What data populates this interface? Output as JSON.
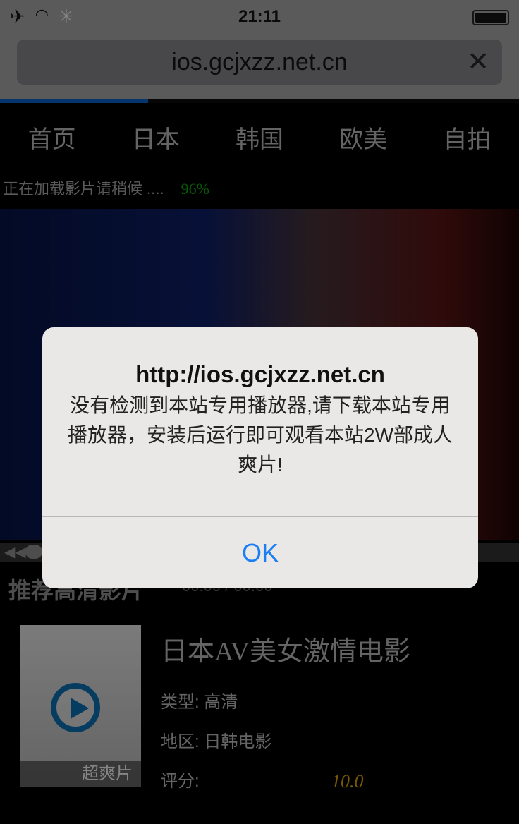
{
  "status_bar": {
    "time": "21:11",
    "icons": [
      "airplane-icon",
      "wifi-icon",
      "activity-spinner-icon",
      "battery-icon"
    ]
  },
  "browser": {
    "url": "ios.gcjxzz.net.cn",
    "load_progress_percent": 28.5
  },
  "nav": {
    "items": [
      "首页",
      "日本",
      "韩国",
      "欧美",
      "自拍"
    ]
  },
  "loading": {
    "text": "正在加载影片请稍候 ....",
    "percent": "96%"
  },
  "player": {
    "timecode": "00:00 / 00:00"
  },
  "section_title": "推荐高清影片",
  "movie": {
    "badge": "超爽片",
    "title": "日本AV美女激情电影",
    "type_label": "类型:",
    "type_value": "高清",
    "region_label": "地区:",
    "region_value": "日韩电影",
    "score_label": "评分:",
    "score_value": "10.0"
  },
  "alert": {
    "title": "http://ios.gcjxzz.net.cn",
    "message": "没有检测到本站专用播放器,请下载本站专用播放器，安装后运行即可观看本站2W部成人爽片!",
    "ok_label": "OK"
  },
  "colors": {
    "accent": "#1a7ef5",
    "progress": "#0a52a8",
    "percent": "#0c8a0c",
    "score": "#b8860b"
  }
}
